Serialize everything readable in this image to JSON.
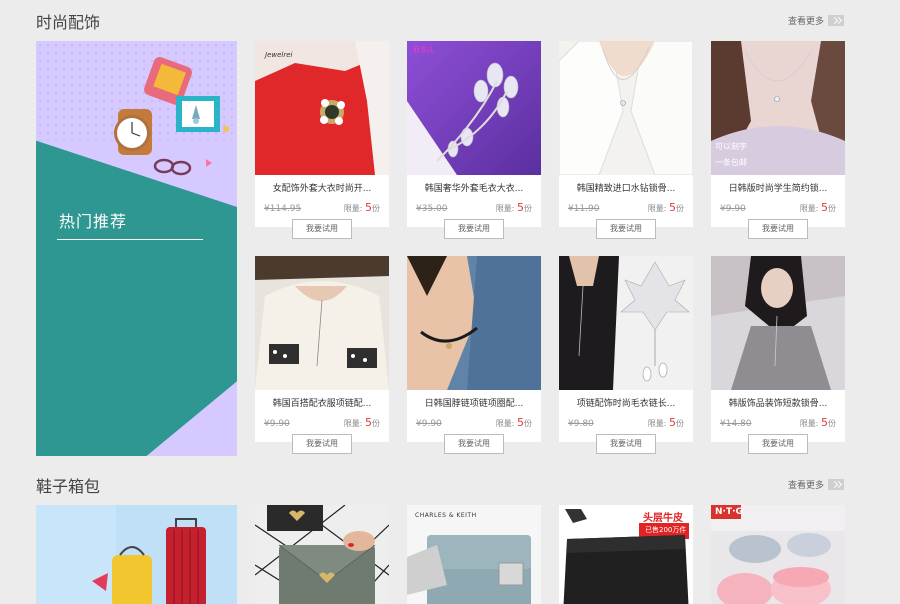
{
  "sections": {
    "accessories": {
      "title": "时尚配饰",
      "more": "查看更多"
    },
    "shoes_bags": {
      "title": "鞋子箱包",
      "more": "查看更多"
    }
  },
  "banner": {
    "title": "热门推荐"
  },
  "products": [
    {
      "name": "女配饰外套大衣时尚开...",
      "price": "¥114.95",
      "limit_label": "限量:",
      "limit_num": "5",
      "limit_unit": "份",
      "button": "我要试用"
    },
    {
      "name": "韩国奢华外套毛衣大衣...",
      "price": "¥35.00",
      "limit_label": "限量:",
      "limit_num": "5",
      "limit_unit": "份",
      "button": "我要试用"
    },
    {
      "name": "韩国精致进口水钻锁骨...",
      "price": "¥11.90",
      "limit_label": "限量:",
      "limit_num": "5",
      "limit_unit": "份",
      "button": "我要试用"
    },
    {
      "name": "日韩版时尚学生简约锁...",
      "price": "¥9.90",
      "limit_label": "限量:",
      "limit_num": "5",
      "limit_unit": "份",
      "button": "我要试用"
    },
    {
      "name": "韩国百搭配衣服项链配...",
      "price": "¥9.90",
      "limit_label": "限量:",
      "limit_num": "5",
      "limit_unit": "份",
      "button": "我要试用"
    },
    {
      "name": "日韩国脖链项链项圈配...",
      "price": "¥9.90",
      "limit_label": "限量:",
      "limit_num": "5",
      "limit_unit": "份",
      "button": "我要试用"
    },
    {
      "name": "项链配饰时尚毛衣链长...",
      "price": "¥9.80",
      "limit_label": "限量:",
      "limit_num": "5",
      "limit_unit": "份",
      "button": "我要试用"
    },
    {
      "name": "韩版饰品装饰短款锁骨...",
      "price": "¥14.80",
      "limit_label": "限量:",
      "limit_num": "5",
      "limit_unit": "份",
      "button": "我要试用"
    }
  ],
  "image_texts": {
    "p1_brand": "Jewelrei",
    "p2_brand": "菲衣儿",
    "p4_line1": "可以刻字",
    "p4_line2": "一条包邮",
    "b2_brand": "CHARLES & KEITH",
    "b4_line1": "头层牛皮",
    "b4_line2": "已售200万件",
    "b5_brand": "N·T·G"
  },
  "colors": {
    "teal": "#2e9791",
    "lavender": "#d6c9ff",
    "price_red": "#e4393c"
  }
}
